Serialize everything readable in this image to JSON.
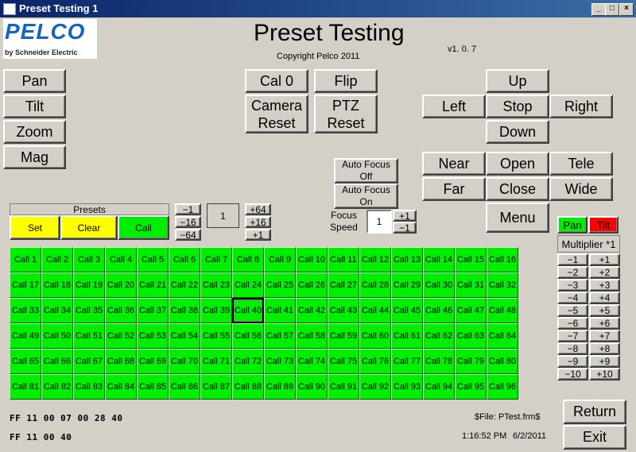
{
  "window": {
    "title": "Preset Testing 1",
    "min_label": "_",
    "max_label": "□",
    "close_label": "×"
  },
  "logo": {
    "brand": "PELCO",
    "tagline": "by Schneider Electric",
    "colors": {
      "brand": "#1565c0",
      "tagline": "#4caf50"
    }
  },
  "header": {
    "title": "Preset Testing",
    "copyright": "Copyright Pelco 2011",
    "version": "v1. 0. 7"
  },
  "left_buttons": {
    "pan": "Pan",
    "tilt": "Tilt",
    "zoom": "Zoom",
    "mag": "Mag"
  },
  "center_buttons": {
    "cal0": "Cal 0",
    "flip": "Flip",
    "camera_reset_1": "Camera",
    "camera_reset_2": "Reset",
    "ptz_reset_1": "PTZ",
    "ptz_reset_2": "Reset"
  },
  "direction": {
    "up": "Up",
    "left": "Left",
    "stop": "Stop",
    "right": "Right",
    "down": "Down"
  },
  "lens": {
    "near": "Near",
    "open": "Open",
    "tele": "Tele",
    "far": "Far",
    "close": "Close",
    "wide": "Wide",
    "menu": "Menu"
  },
  "autofocus": {
    "off_1": "Auto Focus",
    "off_2": "Off",
    "on_1": "Auto Focus",
    "on_2": "On"
  },
  "focus_speed": {
    "label_1": "Focus",
    "label_2": "Speed",
    "value": "1",
    "plus": "+1",
    "minus": "−1"
  },
  "presets": {
    "header": "Presets",
    "set": "Set",
    "clear": "Clear",
    "call": "Call",
    "colors": {
      "yellow": "#ffff00",
      "green": "#00ee00"
    }
  },
  "preset_stepper": {
    "m1": "−1",
    "m16": "−16",
    "m64": "−64",
    "value": "1",
    "p64": "+64",
    "p16": "+16",
    "p1": "+1"
  },
  "pan_tilt_toggle": {
    "pan": "Pan",
    "tilt": "Tilt",
    "colors": {
      "pan": "#00ee00",
      "tilt": "#ff0000"
    }
  },
  "multiplier": {
    "label": "Multiplier *1",
    "rows": [
      [
        "−1",
        "+1"
      ],
      [
        "−2",
        "+2"
      ],
      [
        "−3",
        "+3"
      ],
      [
        "−4",
        "+4"
      ],
      [
        "−5",
        "+5"
      ],
      [
        "−6",
        "+6"
      ],
      [
        "−7",
        "+7"
      ],
      [
        "−8",
        "+8"
      ],
      [
        "−9",
        "+9"
      ],
      [
        "−10",
        "+10"
      ]
    ]
  },
  "call_grid": {
    "prefix": "Call ",
    "count": 96,
    "selected": 40
  },
  "status": {
    "cmd1": "FF  11  00  07  00  28  40",
    "cmd2": "FF  11  00  40",
    "file": "$File: PTest.frm$",
    "time": "1:16:52 PM",
    "date": "6/2/2011"
  },
  "bottom_buttons": {
    "return": "Return",
    "exit": "Exit"
  }
}
